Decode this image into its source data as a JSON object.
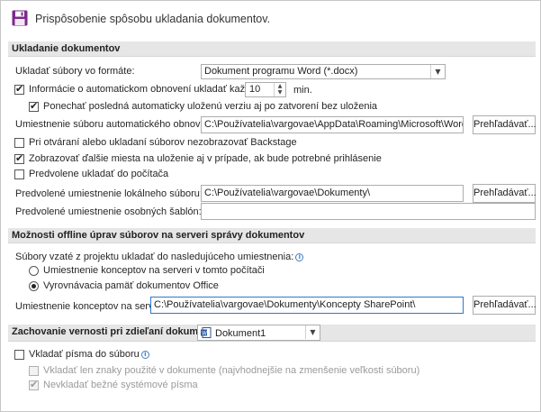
{
  "header": {
    "title": "Prispôsobenie spôsobu ukladania dokumentov.",
    "icon": "save-icon"
  },
  "save_section": {
    "title": "Ukladanie dokumentov",
    "format_label": "Ukladať súbory vo formáte:",
    "format_value": "Dokument programu Word (*.docx)",
    "autorecover_label": "Informácie o automatickom obnovení ukladať každých",
    "autorecover_checked": true,
    "autorecover_minutes": "10",
    "autorecover_unit": "min.",
    "keep_last_label": "Ponechať posledná automaticky uloženú verziu aj po zatvorení bez uloženia",
    "keep_last_checked": true,
    "autorecover_location_label": "Umiestnenie súboru automatického obnovenia:",
    "autorecover_location_value": "C:\\Používatelia\\vargovae\\AppData\\Roaming\\Microsoft\\Word\\",
    "browse_label": "Prehľadávať...",
    "backstage_label": "Pri otváraní alebo ukladaní súborov nezobrazovať Backstage",
    "backstage_checked": false,
    "show_more_label": "Zobrazovať ďalšie miesta na uloženie aj v prípade, ak bude potrebné prihlásenie",
    "show_more_checked": true,
    "default_computer_label": "Predvolene ukladať do počítača",
    "default_computer_checked": false,
    "default_local_label": "Predvolené umiestnenie lokálneho súboru:",
    "default_local_value": "C:\\Používatelia\\vargovae\\Dokumenty\\",
    "templates_label": "Predvolené umiestnenie osobných šablón:",
    "templates_value": ""
  },
  "offline_section": {
    "title": "Možnosti offline úprav súborov na serveri správy dokumentov",
    "checked_out_label": "Súbory vzaté z projektu ukladať do nasledujúceho umiestnenia:",
    "radio_server": "Umiestnenie konceptov na serveri v tomto počítači",
    "radio_server_selected": false,
    "radio_cache": "Vyrovnávacia pamäť dokumentov Office",
    "radio_cache_selected": true,
    "drafts_label": "Umiestnenie konceptov na serveri:",
    "drafts_value": "C:\\Používatelia\\vargovae\\Dokumenty\\Koncepty SharePoint\\",
    "browse_label": "Prehľadávať..."
  },
  "fidelity_section": {
    "title": "Zachovanie vernosti pri zdieľaní dokumentu:",
    "document_value": "Dokument1",
    "embed_fonts_label": "Vkladať písma do súboru",
    "embed_fonts_checked": false,
    "embed_used_label": "Vkladať len znaky použité v dokumente (najvhodnejšie na zmenšenie veľkosti súboru)",
    "embed_used_checked": false,
    "no_common_label": "Nevkladať bežné systémové písma",
    "no_common_checked": true
  },
  "colors": {
    "section_bg": "#e6e6e6",
    "accent": "#2b79d0",
    "save_icon": "#7b2b8b"
  }
}
